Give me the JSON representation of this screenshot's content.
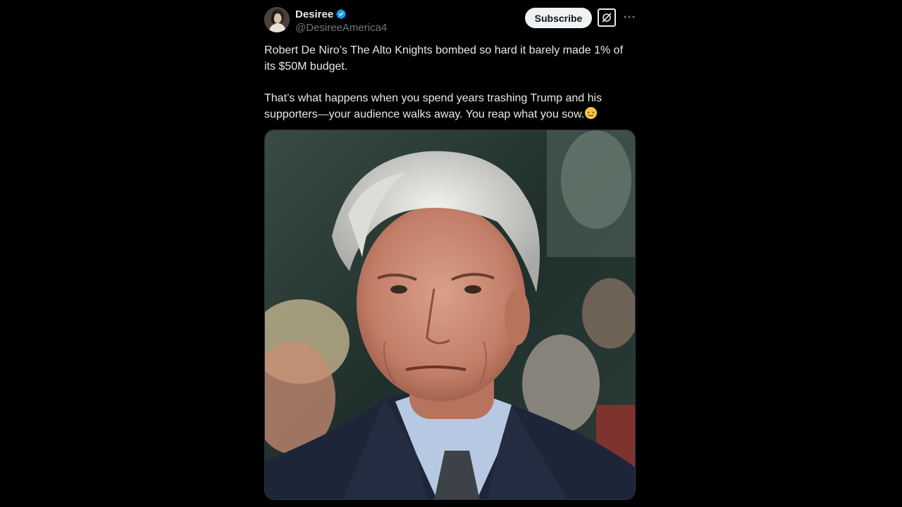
{
  "author": {
    "display_name": "Desiree",
    "handle": "@DesireeAmerica4",
    "verified": true,
    "verified_color": "#1d9bf0",
    "avatar_icon": "profile-photo"
  },
  "actions": {
    "subscribe_label": "Subscribe",
    "grok_icon": "grok-icon",
    "more_icon": "more-horizontal-icon"
  },
  "post": {
    "paragraph_1": "Robert De Niro’s The Alto Knights bombed so hard it barely made 1% of its $50M budget.",
    "paragraph_2": "That’s what happens when you spend years trashing Trump and his supporters—your audience walks away. You reap what you sow.",
    "trailing_emoji": "relieved-face-emoji"
  },
  "media": {
    "type": "photo",
    "subject": "portrait-photo"
  },
  "colors": {
    "background": "#000000",
    "text": "#e7e9ea",
    "secondary_text": "#71767b",
    "button_bg": "#eff3f4",
    "button_text": "#0f1419"
  }
}
